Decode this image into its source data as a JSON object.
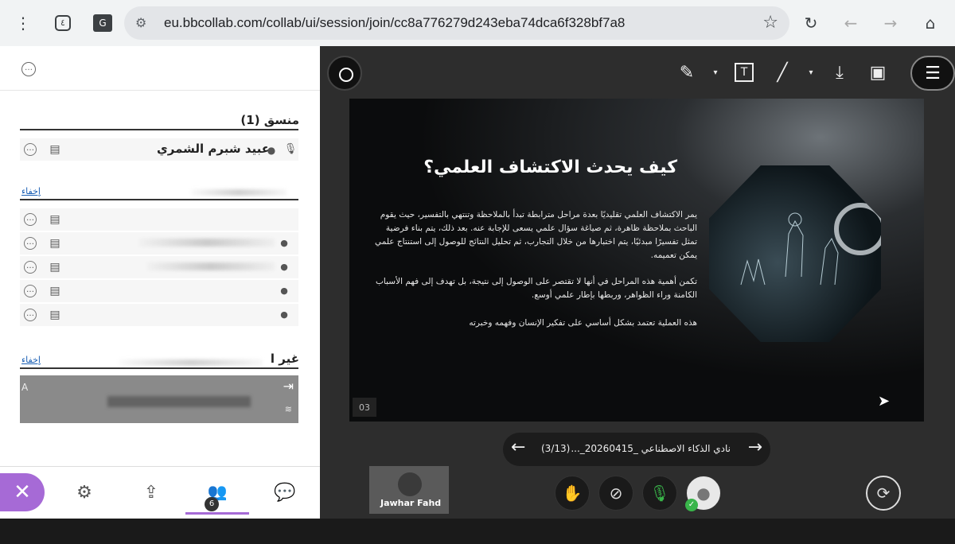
{
  "browser": {
    "url": "eu.bbcollab.com/collab/ui/session/join/cc8a776279d243eba74dca6f328bf7a8",
    "icons": [
      "more-icon",
      "tab-count-icon",
      "translate-icon",
      "site-settings-icon",
      "star-icon",
      "refresh-icon",
      "back-icon",
      "forward-icon",
      "home-icon"
    ],
    "tab_count": "٤"
  },
  "sidebar": {
    "moderator_section": "منسق (1)",
    "moderator_name": "عبيد شبرم الشمري",
    "hide_label_1": "إخفاء",
    "hide_label_2": "إخفاء",
    "other_section": "غير ا",
    "card_letter": "A",
    "tab_badge": "6"
  },
  "slide": {
    "title": "كيف يحدث الاكتشاف العلمي؟",
    "paragraph1": "يمر الاكتشاف العلمي تقليديًا بعدة مراحل مترابطة تبدأ بالملاحظة وتنتهي بالتفسير، حيث يقوم الباحث بملاحظة ظاهرة، ثم صياغة سؤال علمي يسعى للإجابة عنه. بعد ذلك، يتم بناء فرضية تمثل تفسيرًا مبدئيًا، يتم اختبارها من خلال التجارب، ثم تحليل النتائج للوصول إلى استنتاج علمي يمكن تعميمه.",
    "paragraph2": "تكمن أهمية هذه المراحل في أنها لا تقتصر على الوصول إلى نتيجة، بل تهدف إلى فهم الأسباب الكامنة وراء الظواهر، وربطها بإطار علمي أوسع.",
    "paragraph3": "هذه العملية تعتمد بشكل أساسي على تفكير الإنسان وفهمه وخبرته",
    "number": "03"
  },
  "navigation": {
    "file_name": "نادي الذكاء الاصطناعي _20260415_...",
    "page": "(3/13)"
  },
  "video": {
    "name": "Jawhar Fahd"
  },
  "colors": {
    "accent_purple": "#a66ad6",
    "mic_green": "#39b54a",
    "main_bg": "#2d2d2d"
  }
}
